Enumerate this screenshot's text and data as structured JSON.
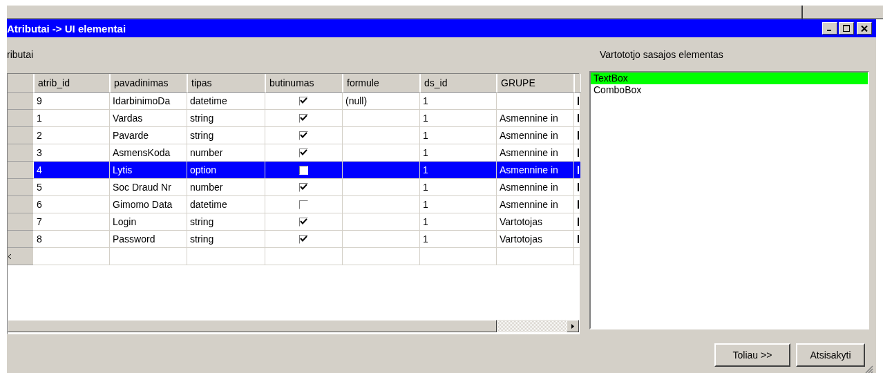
{
  "window": {
    "title": "Atributai -> UI elementai"
  },
  "left_label": "ributai",
  "table": {
    "columns": [
      "atrib_id",
      "pavadinimas",
      "tipas",
      "butinumas",
      "formule",
      "ds_id",
      "GRUPE"
    ],
    "rows": [
      {
        "atrib_id": "9",
        "pavadinimas": "IdarbinimoDa",
        "tipas": "datetime",
        "butinumas": true,
        "formule": "(null)",
        "ds_id": "1",
        "grupe": "",
        "selected": false
      },
      {
        "atrib_id": "1",
        "pavadinimas": "Vardas",
        "tipas": "string",
        "butinumas": true,
        "formule": "",
        "ds_id": "1",
        "grupe": "Asmennine in",
        "selected": false
      },
      {
        "atrib_id": "2",
        "pavadinimas": "Pavarde",
        "tipas": "string",
        "butinumas": true,
        "formule": "",
        "ds_id": "1",
        "grupe": "Asmennine in",
        "selected": false
      },
      {
        "atrib_id": "3",
        "pavadinimas": "AsmensKoda",
        "tipas": "number",
        "butinumas": true,
        "formule": "",
        "ds_id": "1",
        "grupe": "Asmennine in",
        "selected": false
      },
      {
        "atrib_id": "4",
        "pavadinimas": "Lytis",
        "tipas": "option",
        "butinumas": false,
        "formule": "",
        "ds_id": "1",
        "grupe": "Asmennine in",
        "selected": true
      },
      {
        "atrib_id": "5",
        "pavadinimas": "Soc Draud Nr",
        "tipas": "number",
        "butinumas": true,
        "formule": "",
        "ds_id": "1",
        "grupe": "Asmennine in",
        "selected": false
      },
      {
        "atrib_id": "6",
        "pavadinimas": "Gimomo Data",
        "tipas": "datetime",
        "butinumas": false,
        "formule": "",
        "ds_id": "1",
        "grupe": "Asmennine in",
        "selected": false
      },
      {
        "atrib_id": "7",
        "pavadinimas": "Login",
        "tipas": "string",
        "butinumas": true,
        "formule": "",
        "ds_id": "1",
        "grupe": "Vartotojas",
        "selected": false
      },
      {
        "atrib_id": "8",
        "pavadinimas": "Password",
        "tipas": "string",
        "butinumas": true,
        "formule": "",
        "ds_id": "1",
        "grupe": "Vartotojas",
        "selected": false
      }
    ]
  },
  "right_label": "Vartototjo sasajos elementas",
  "ui_elements": [
    {
      "label": "TextBox",
      "selected": true
    },
    {
      "label": "ComboBox",
      "selected": false
    }
  ],
  "buttons": [
    "Toliau >>",
    "Atsisakyti"
  ]
}
